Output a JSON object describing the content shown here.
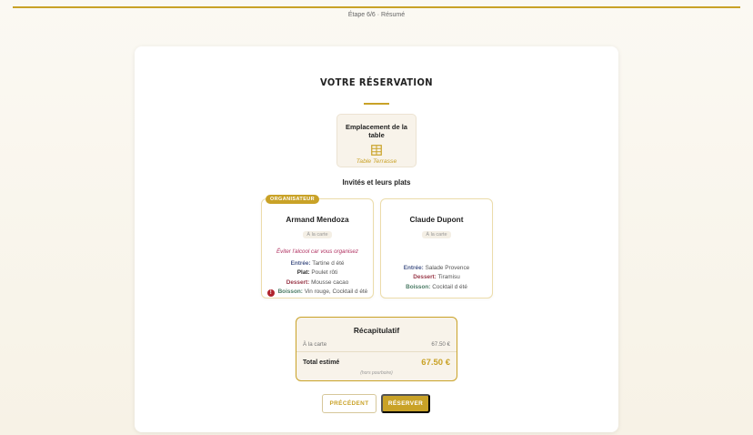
{
  "progress": {
    "fraction": 1.0,
    "step_label": "Étape 6/6 · Résumé"
  },
  "reservation": {
    "title": "VOTRE RÉSERVATION",
    "table": {
      "heading": "Emplacement de la table",
      "icon": "table-grid-icon",
      "value": "Table Terrasse"
    },
    "guests_heading": "Invités et leurs plats",
    "guests": [
      {
        "badge": "ORGANISATEUR",
        "name": "Armand Mendoza",
        "mode": "À la carte",
        "note": "Éviter l'alcool car vous organisez",
        "entree_label": "Entrée:",
        "entree": "Tartine d été",
        "plat_label": "Plat:",
        "plat": "Poulet rôti",
        "dessert_label": "Dessert:",
        "dessert": "Mousse cacao",
        "boisson_label": "Boisson:",
        "boisson": "Vin rouge, Cocktail d été",
        "warning_icon": "!"
      },
      {
        "name": "Claude Dupont",
        "mode": "À la carte",
        "entree_label": "Entrée:",
        "entree": "Salade Provence",
        "dessert_label": "Dessert:",
        "dessert": "Tiramisu",
        "boisson_label": "Boisson:",
        "boisson": "Cocktail d été"
      }
    ],
    "summary": {
      "title": "Récapitulatif",
      "line_label": "À la carte",
      "line_value": "67.50 €",
      "total_label": "Total estimé",
      "total_value": "67.50 €",
      "note": "(hors pourboire)"
    },
    "buttons": {
      "previous": "PRÉCÉDENT",
      "book": "RÉSERVER"
    }
  },
  "colors": {
    "accent": "#c9a227",
    "warning": "#b0242d"
  }
}
